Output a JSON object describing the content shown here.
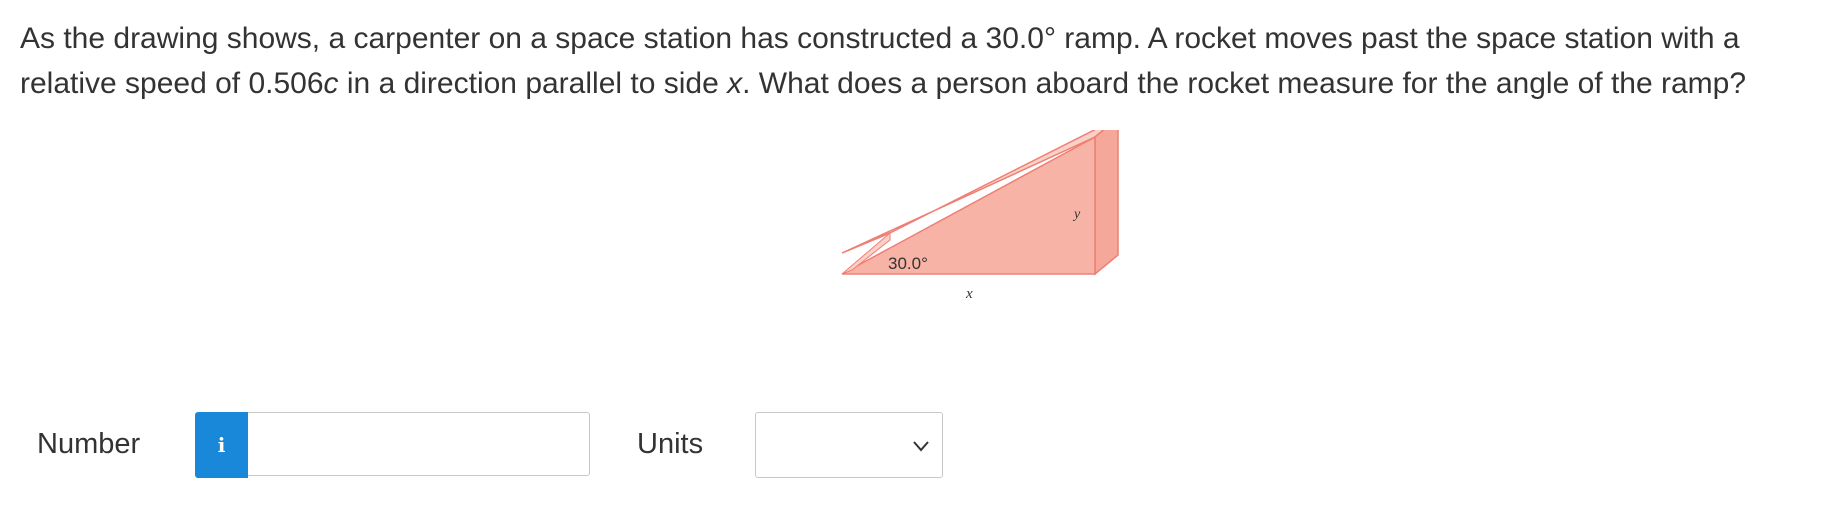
{
  "question": {
    "part1": "As the drawing shows, a carpenter on a space station has constructed a 30.0° ramp. A rocket moves past the space station with a relative speed of 0.506",
    "var_c": "c",
    "part2": " in a direction parallel to side ",
    "var_x": "x",
    "part3": ". What does a person aboard the rocket measure for the angle of the ramp?"
  },
  "figure": {
    "angle_label": "30.0°",
    "side_x_label": "x",
    "side_y_label": "y",
    "colors": {
      "face": "#f7b3a6",
      "edge": "#ef7f74",
      "top": "#fbd0c6"
    }
  },
  "answer": {
    "number_label": "Number",
    "info_icon_glyph": "i",
    "number_value": "",
    "units_label": "Units",
    "units_selected": "",
    "info_color": "#1a88d8"
  }
}
